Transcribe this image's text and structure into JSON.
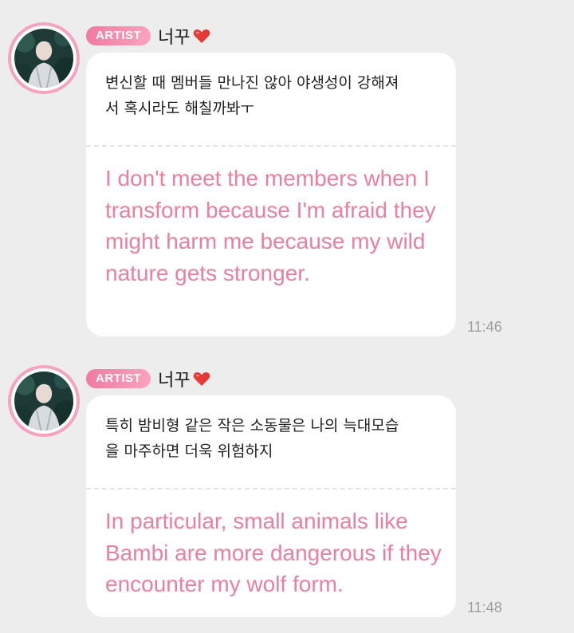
{
  "messages": [
    {
      "badge": "ARTIST",
      "name": "너꾸",
      "heart_icon": "red-heart-emoji",
      "korean_text": "변신할 때 멤버들 만나진 않아 야생성이 강해져\n서 혹시라도 해칠까봐ㅜ",
      "english_text": "I don't meet the members when I transform because I'm afraid they might harm me because my wild nature gets stronger.",
      "time": "11:46"
    },
    {
      "badge": "ARTIST",
      "name": "너꾸",
      "heart_icon": "red-heart-emoji",
      "korean_text": "특히 밤비형 같은 작은 소동물은 나의 늑대모습\n을 마주하면 더욱 위험하지",
      "english_text": "In particular, small animals like Bambi are more dangerous if they encounter my wolf form.",
      "time": "11:48"
    }
  ],
  "colors": {
    "background": "#ededed",
    "badge": "#f07aa0",
    "translation": "#e8809f",
    "timestamp": "#9e9e9e",
    "avatar_ring": "#f4a5bd"
  }
}
